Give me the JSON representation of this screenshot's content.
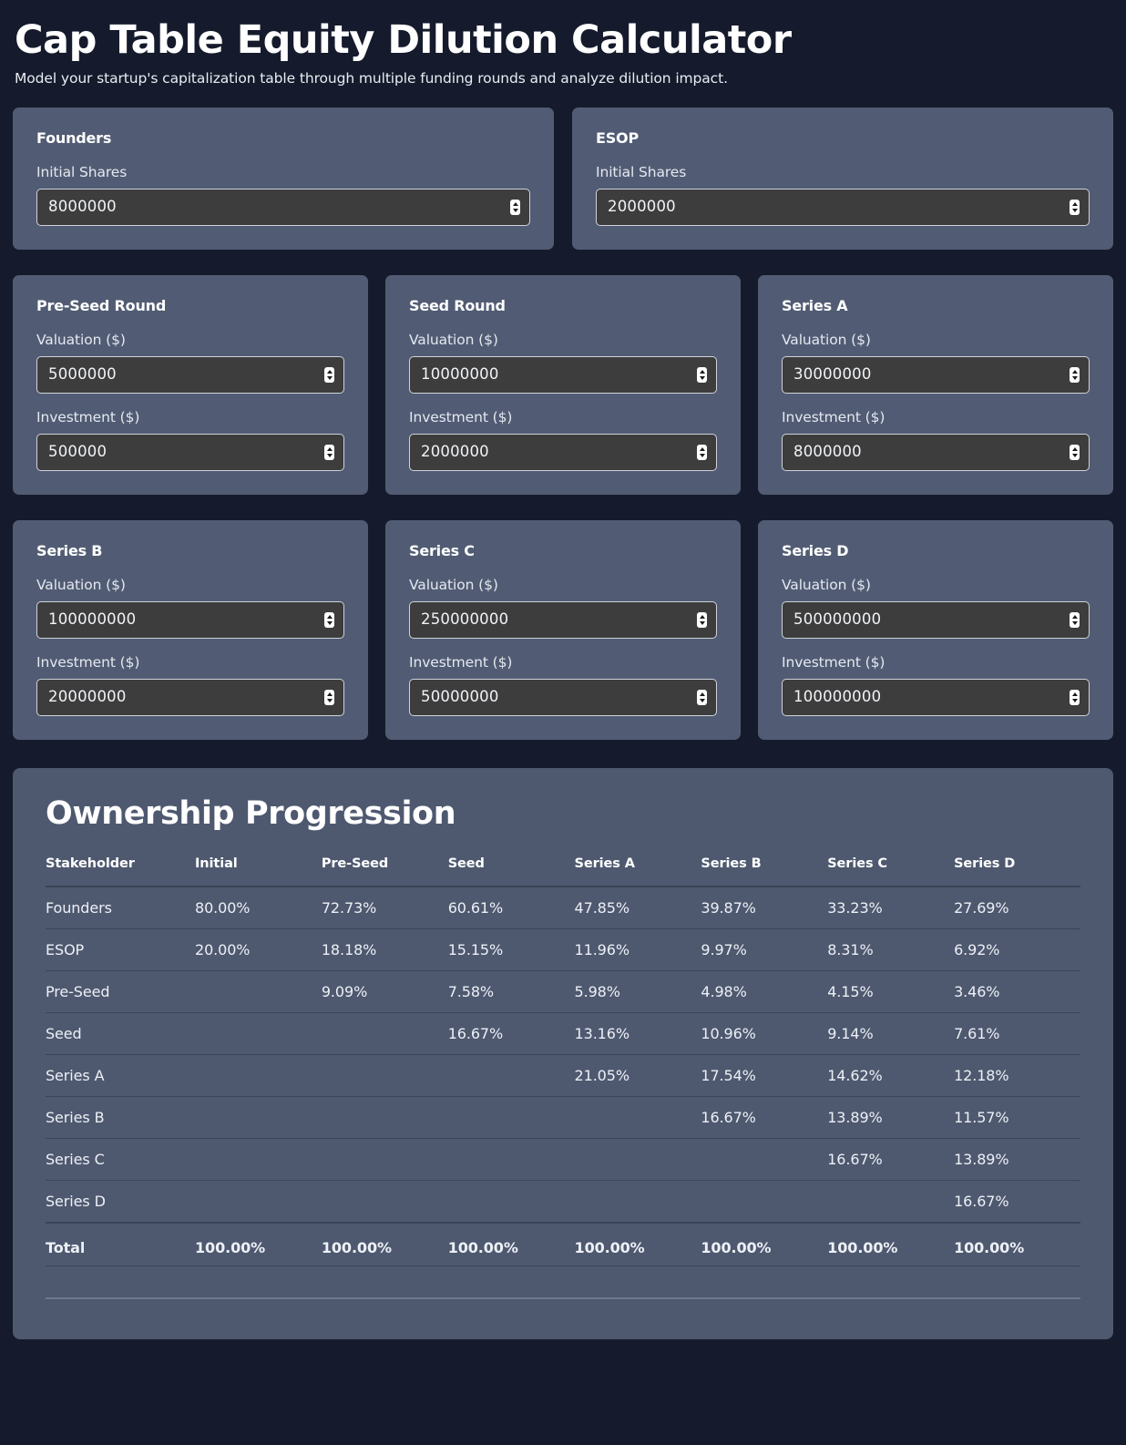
{
  "header": {
    "title": "Cap Table Equity Dilution Calculator",
    "subtitle": "Model your startup's capitalization table through multiple funding rounds and analyze dilution impact."
  },
  "colors": {
    "page_background": "#151b2c",
    "card_background": "#515c74",
    "panel_background": "#4e5970",
    "input_background": "#3d3d3d",
    "text_primary": "#ffffff",
    "divider": "#3b4457"
  },
  "stakeholder_cards": [
    {
      "title": "Founders",
      "fields": [
        {
          "label": "Initial Shares",
          "value": "8000000",
          "icon": "number-spinner-icon"
        }
      ]
    },
    {
      "title": "ESOP",
      "fields": [
        {
          "label": "Initial Shares",
          "value": "2000000",
          "icon": "number-spinner-icon"
        }
      ]
    }
  ],
  "round_cards": [
    {
      "title": "Pre-Seed Round",
      "fields": [
        {
          "label": "Valuation ($)",
          "value": "5000000",
          "icon": "number-spinner-icon"
        },
        {
          "label": "Investment ($)",
          "value": "500000",
          "icon": "number-spinner-icon"
        }
      ]
    },
    {
      "title": "Seed Round",
      "fields": [
        {
          "label": "Valuation ($)",
          "value": "10000000",
          "icon": "number-spinner-icon"
        },
        {
          "label": "Investment ($)",
          "value": "2000000",
          "icon": "number-spinner-icon"
        }
      ]
    },
    {
      "title": "Series A",
      "fields": [
        {
          "label": "Valuation ($)",
          "value": "30000000",
          "icon": "number-spinner-icon"
        },
        {
          "label": "Investment ($)",
          "value": "8000000",
          "icon": "number-spinner-icon"
        }
      ]
    },
    {
      "title": "Series B",
      "fields": [
        {
          "label": "Valuation ($)",
          "value": "100000000",
          "icon": "number-spinner-icon"
        },
        {
          "label": "Investment ($)",
          "value": "20000000",
          "icon": "number-spinner-icon"
        }
      ]
    },
    {
      "title": "Series C",
      "fields": [
        {
          "label": "Valuation ($)",
          "value": "250000000",
          "icon": "number-spinner-icon"
        },
        {
          "label": "Investment ($)",
          "value": "50000000",
          "icon": "number-spinner-icon"
        }
      ]
    },
    {
      "title": "Series D",
      "fields": [
        {
          "label": "Valuation ($)",
          "value": "500000000",
          "icon": "number-spinner-icon"
        },
        {
          "label": "Investment ($)",
          "value": "100000000",
          "icon": "number-spinner-icon"
        }
      ]
    }
  ],
  "results": {
    "title": "Ownership Progression",
    "columns": [
      "Stakeholder",
      "Initial",
      "Pre-Seed",
      "Seed",
      "Series A",
      "Series B",
      "Series C",
      "Series D"
    ],
    "rows": [
      {
        "name": "Founders",
        "values": [
          "80.00%",
          "72.73%",
          "60.61%",
          "47.85%",
          "39.87%",
          "33.23%",
          "27.69%"
        ]
      },
      {
        "name": "ESOP",
        "values": [
          "20.00%",
          "18.18%",
          "15.15%",
          "11.96%",
          "9.97%",
          "8.31%",
          "6.92%"
        ]
      },
      {
        "name": "Pre-Seed",
        "values": [
          "",
          "9.09%",
          "7.58%",
          "5.98%",
          "4.98%",
          "4.15%",
          "3.46%"
        ]
      },
      {
        "name": "Seed",
        "values": [
          "",
          "",
          "16.67%",
          "13.16%",
          "10.96%",
          "9.14%",
          "7.61%"
        ]
      },
      {
        "name": "Series A",
        "values": [
          "",
          "",
          "",
          "21.05%",
          "17.54%",
          "14.62%",
          "12.18%"
        ]
      },
      {
        "name": "Series B",
        "values": [
          "",
          "",
          "",
          "",
          "16.67%",
          "13.89%",
          "11.57%"
        ]
      },
      {
        "name": "Series C",
        "values": [
          "",
          "",
          "",
          "",
          "",
          "16.67%",
          "13.89%"
        ]
      },
      {
        "name": "Series D",
        "values": [
          "",
          "",
          "",
          "",
          "",
          "",
          "16.67%"
        ]
      }
    ],
    "total_row": {
      "name": "Total",
      "values": [
        "100.00%",
        "100.00%",
        "100.00%",
        "100.00%",
        "100.00%",
        "100.00%",
        "100.00%"
      ]
    }
  }
}
